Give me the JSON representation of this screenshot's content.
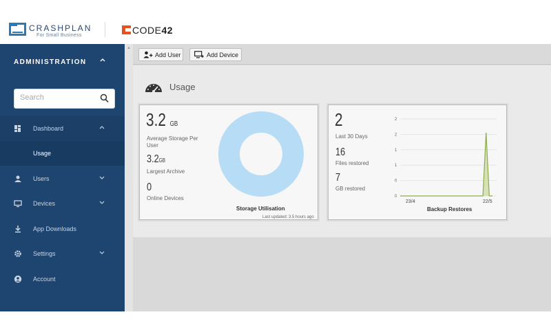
{
  "header": {
    "crashplan_name": "CRASHPLAN",
    "crashplan_sub": "For Small Business",
    "code42_bold": "CODE",
    "code42_num": "42"
  },
  "sidebar": {
    "section_title": "ADMINISTRATION",
    "search_placeholder": "Search",
    "items": [
      {
        "label": "Dashboard",
        "icon": "dashboard-icon",
        "expanded": true
      },
      {
        "label": "Usage",
        "icon": "",
        "selected": true
      },
      {
        "label": "Users",
        "icon": "user-icon"
      },
      {
        "label": "Devices",
        "icon": "monitor-icon"
      },
      {
        "label": "App Downloads",
        "icon": "download-icon"
      },
      {
        "label": "Settings",
        "icon": "gear-icon"
      },
      {
        "label": "Account",
        "icon": "account-icon"
      }
    ]
  },
  "toolbar": {
    "add_user_label": "Add User",
    "add_device_label": "Add Device"
  },
  "page": {
    "title": "Usage"
  },
  "storage_card": {
    "avg_storage_value": "3.2",
    "avg_storage_unit": "GB",
    "avg_storage_label": "Average Storage Per User",
    "largest_archive_value": "3.2",
    "largest_archive_unit": "GB",
    "largest_archive_label": "Largest Archive",
    "online_devices_value": "0",
    "online_devices_label": "Online Devices",
    "chart_title": "Storage Utilisation",
    "last_updated": "Last updated: 3.5 hours ago"
  },
  "restores_card": {
    "restores_value": "2",
    "restores_label": "Last 30 Days",
    "files_value": "16",
    "files_label": "Files restored",
    "gb_value": "7",
    "gb_label": "GB restored",
    "chart_title": "Backup Restores"
  },
  "colors": {
    "sidebar_bg": "#1e4570",
    "donut": "#b7dcf5",
    "restore_line": "#8bab4a",
    "restore_fill": "#d6e2b6",
    "code42_orange": "#e8511d",
    "crashplan_blue": "#2a7ab8"
  },
  "chart_data": [
    {
      "type": "pie",
      "title": "Storage Utilisation",
      "values": [
        100
      ],
      "colors": [
        "#b7dcf5"
      ]
    },
    {
      "type": "area",
      "title": "Backup Restores",
      "x": [
        "23/4",
        "22/5"
      ],
      "ytick_labels": [
        "0",
        "0",
        "1",
        "1",
        "2",
        "2"
      ],
      "ylim": [
        0,
        2
      ],
      "series": [
        {
          "values": [
            0,
            0,
            0,
            0,
            0,
            0,
            0,
            0,
            0,
            0,
            0,
            0,
            0,
            0,
            0,
            0,
            0,
            0,
            0,
            0,
            0,
            0,
            0,
            0,
            0,
            0,
            0,
            2,
            0,
            0
          ]
        }
      ],
      "grid": true
    }
  ]
}
